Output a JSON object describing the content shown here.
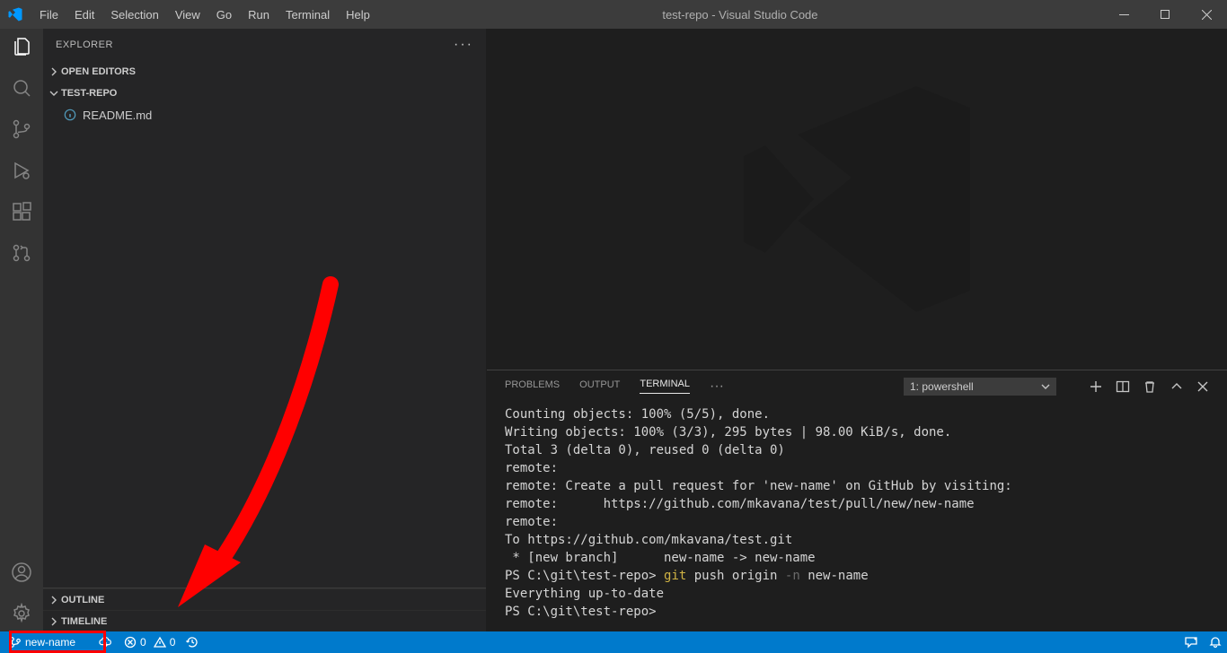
{
  "title": "test-repo - Visual Studio Code",
  "menu": [
    "File",
    "Edit",
    "Selection",
    "View",
    "Go",
    "Run",
    "Terminal",
    "Help"
  ],
  "sidebar": {
    "title": "EXPLORER",
    "openEditors": "OPEN EDITORS",
    "repo": "TEST-REPO",
    "files": [
      "README.md"
    ],
    "outline": "OUTLINE",
    "timeline": "TIMELINE"
  },
  "panel": {
    "tabs": [
      "PROBLEMS",
      "OUTPUT",
      "TERMINAL"
    ],
    "more": "···",
    "selector": "1: powershell",
    "terminal_lines": [
      {
        "text": "Counting objects: 100% (5/5), done."
      },
      {
        "text": "Writing objects: 100% (3/3), 295 bytes | 98.00 KiB/s, done."
      },
      {
        "text": "Total 3 (delta 0), reused 0 (delta 0)"
      },
      {
        "text": "remote:"
      },
      {
        "text": "remote: Create a pull request for 'new-name' on GitHub by visiting:"
      },
      {
        "text": "remote:      https://github.com/mkavana/test/pull/new/new-name"
      },
      {
        "text": "remote:"
      },
      {
        "text": "To https://github.com/mkavana/test.git"
      },
      {
        "text": " * [new branch]      new-name -> new-name"
      },
      {
        "prompt": "PS C:\\git\\test-repo> ",
        "cmd_gold": "git ",
        "cmd": "push origin ",
        "cmd_gray": "-n ",
        "cmd2": "new-name"
      },
      {
        "text": "Everything up-to-date"
      },
      {
        "prompt": "PS C:\\git\\test-repo> "
      }
    ]
  },
  "status": {
    "branch": "new-name",
    "errors": "0",
    "warnings": "0"
  }
}
